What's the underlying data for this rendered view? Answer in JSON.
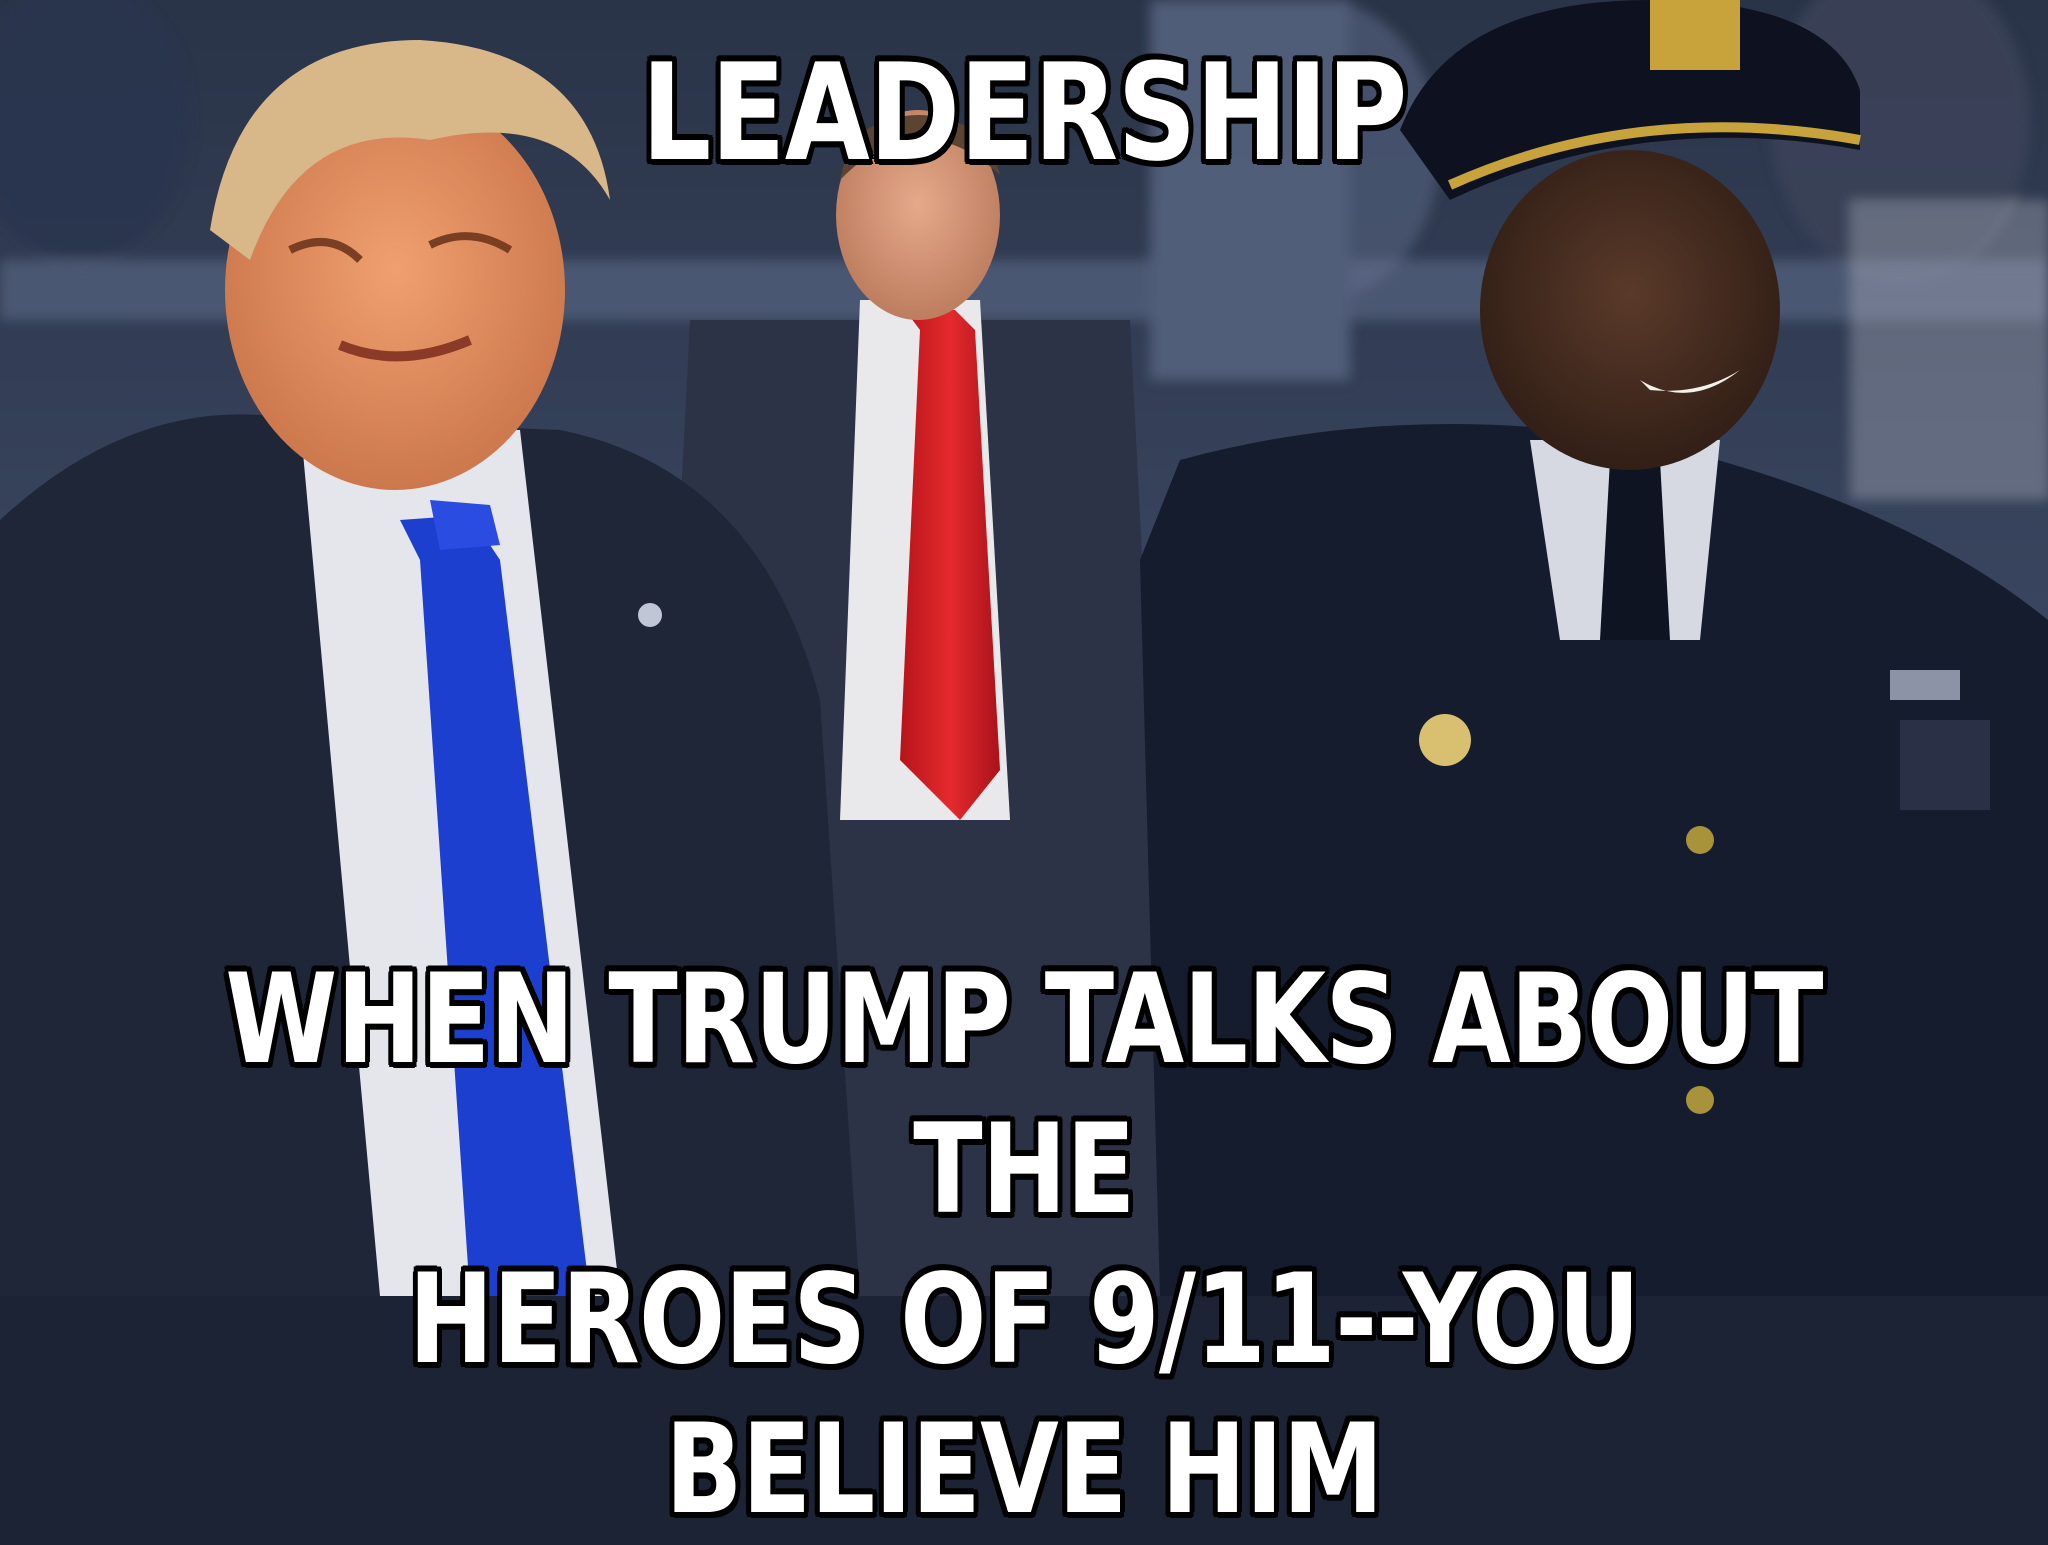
{
  "meme": {
    "top_text": "LEADERSHIP",
    "bottom_line_1": "WHEN TRUMP TALKS ABOUT THE",
    "bottom_line_2": "HEROES OF 9/11--YOU BELIEVE HIM"
  },
  "colors": {
    "caption_fill": "#ffffff",
    "caption_outline": "#000000",
    "blue_tie": "#1d3fd0",
    "red_tie": "#d81e24",
    "police_uniform": "#151c2e"
  }
}
